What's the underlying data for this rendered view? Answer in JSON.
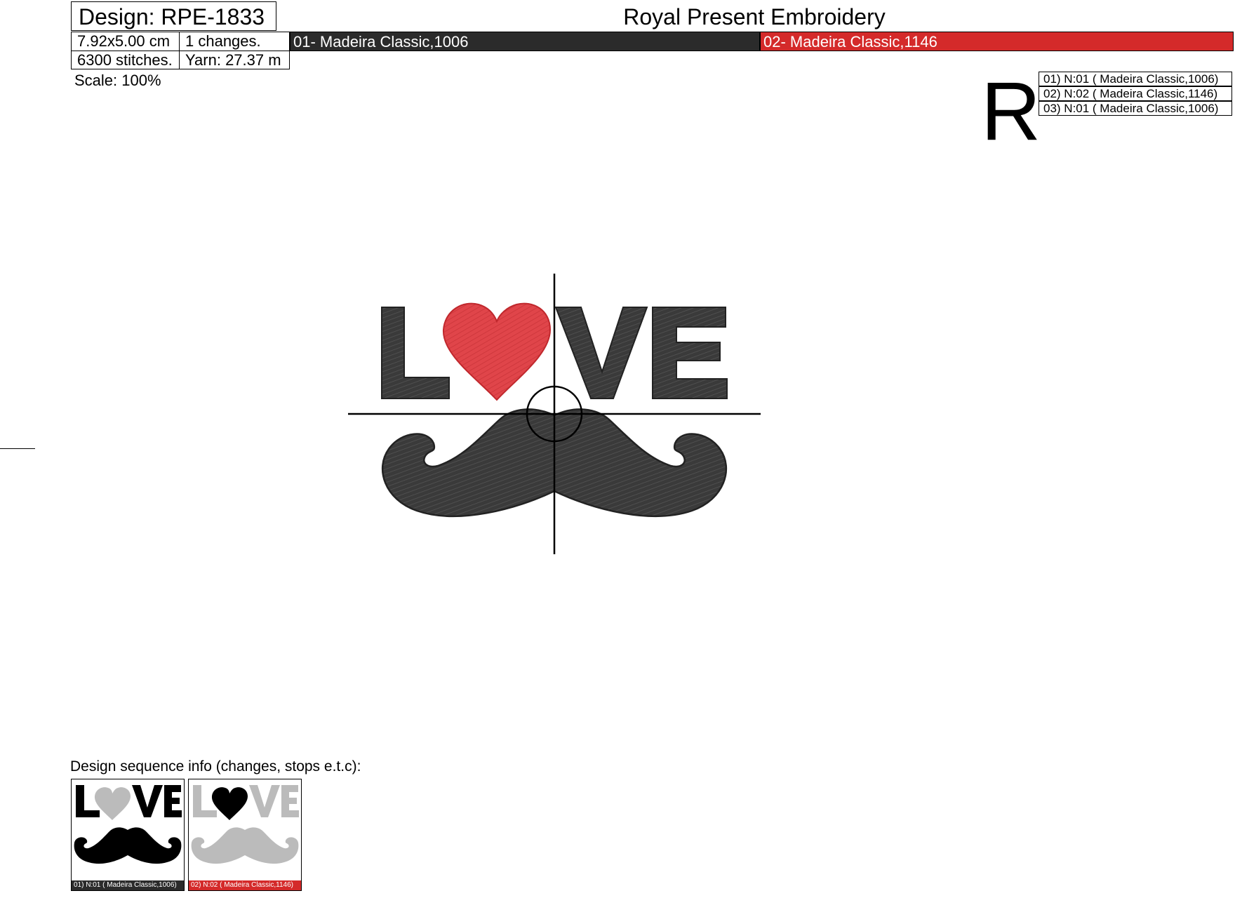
{
  "header": {
    "design_title": "Design: RPE-1833",
    "brand": "Royal Present Embroidery",
    "size": "7.92x5.00 cm",
    "changes": "1 changes.",
    "stitches": "6300 stitches.",
    "yarn": "Yarn: 27.37 m",
    "scale": "Scale: 100%"
  },
  "thread_bars": [
    {
      "label": "01- Madeira Classic,1006",
      "color": "#2b2b2b"
    },
    {
      "label": "02- Madeira Classic,1146",
      "color": "#d42a2a"
    }
  ],
  "orientation_mark": "R",
  "sequence_legend": [
    "01) N:01 ( Madeira Classic,1006)",
    "02) N:02 ( Madeira Classic,1146)",
    "03) N:01 ( Madeira Classic,1006)"
  ],
  "design": {
    "text_parts": [
      "L",
      "VE"
    ],
    "thread_dark": "#3a3a3a",
    "thread_red": "#e0454a"
  },
  "sequence": {
    "label": "Design sequence info (changes, stops e.t.c):",
    "thumbs": [
      {
        "label": "01) N:01 ( Madeira Classic,1006)",
        "label_color": "#2b2b2b",
        "active": "dark"
      },
      {
        "label": "02) N:02 ( Madeira Classic,1146)",
        "label_color": "#d42a2a",
        "active": "red"
      }
    ]
  }
}
